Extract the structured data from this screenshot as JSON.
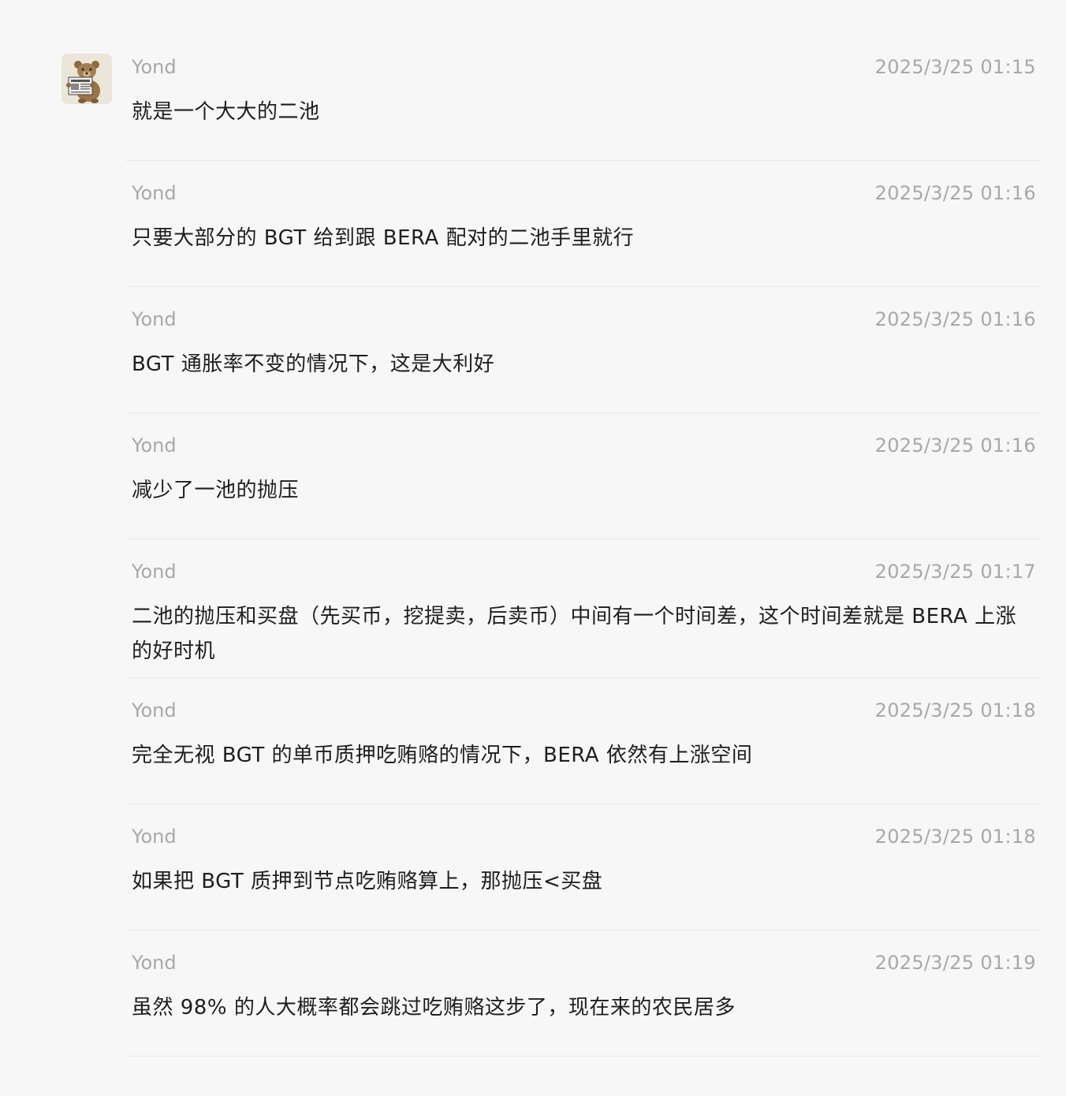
{
  "messages": [
    {
      "sender": "Yond",
      "time": "2025/3/25 01:15",
      "text": "就是一个大大的二池"
    },
    {
      "sender": "Yond",
      "time": "2025/3/25 01:16",
      "text": "只要大部分的 BGT 给到跟 BERA 配对的二池手里就行"
    },
    {
      "sender": "Yond",
      "time": "2025/3/25 01:16",
      "text": "BGT 通胀率不变的情况下，这是大利好"
    },
    {
      "sender": "Yond",
      "time": "2025/3/25 01:16",
      "text": "减少了一池的抛压"
    },
    {
      "sender": "Yond",
      "time": "2025/3/25 01:17",
      "text": "二池的抛压和买盘（先买币，挖提卖，后卖币）中间有一个时间差，这个时间差就是 BERA 上涨的好时机"
    },
    {
      "sender": "Yond",
      "time": "2025/3/25 01:18",
      "text": "完全无视 BGT 的单币质押吃贿赂的情况下，BERA 依然有上涨空间"
    },
    {
      "sender": "Yond",
      "time": "2025/3/25 01:18",
      "text": "如果把 BGT 质押到节点吃贿赂算上，那抛压<买盘"
    },
    {
      "sender": "Yond",
      "time": "2025/3/25 01:19",
      "text": "虽然 98% 的人大概率都会跳过吃贿赂这步了，现在来的农民居多"
    }
  ],
  "avatar": {
    "icon": "bear-reading-newspaper-icon"
  }
}
